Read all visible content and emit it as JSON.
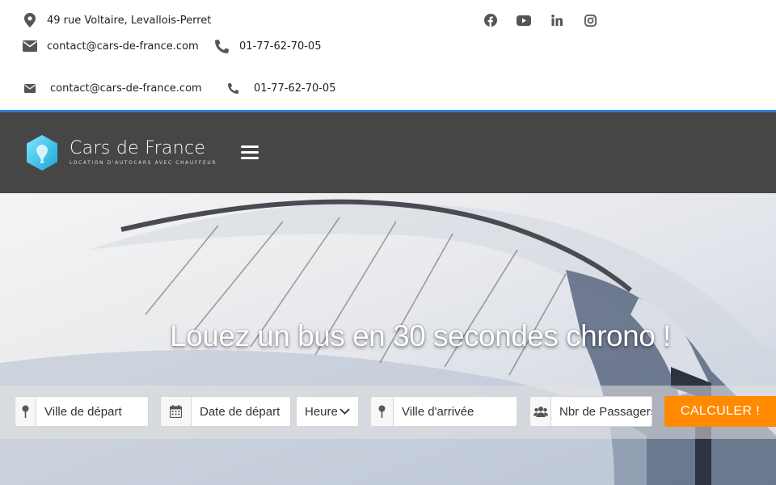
{
  "contact": {
    "address": "49 rue Voltaire, Levallois-Perret",
    "email": "contact@cars-de-france.com",
    "phone": "01-77-62-70-05"
  },
  "contact_repeat": {
    "email": "contact@cars-de-france.com",
    "phone": "01-77-62-70-05"
  },
  "social": [
    "facebook-icon",
    "youtube-icon",
    "linkedin-icon",
    "instagram-icon"
  ],
  "brand": {
    "name": "Cars de France",
    "tagline": "Location d'autocars avec chauffeur"
  },
  "hero": {
    "title": "Louez un bus en 30 secondes chrono !"
  },
  "form": {
    "departure_placeholder": "Ville de départ",
    "date_placeholder": "Date de départ",
    "hour_label": "Heure",
    "arrival_placeholder": "Ville d'arrivée",
    "passengers_placeholder": "Nbr de Passagers",
    "submit_label": "CALCULER !"
  },
  "colors": {
    "accent": "#ff8a00",
    "navbar": "#464646",
    "topline": "#2e7bd6"
  }
}
